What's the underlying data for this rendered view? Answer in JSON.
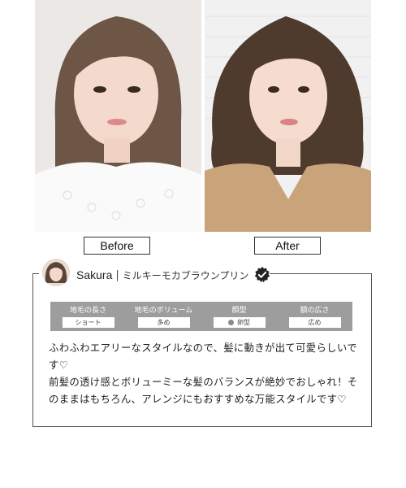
{
  "photos": {
    "before_alt": "Before",
    "after_alt": "After"
  },
  "labels": {
    "before": "Before",
    "after": "After"
  },
  "review": {
    "reviewer_name": "Sakura",
    "separator": "|",
    "style_name": "ミルキーモカブラウンプリン",
    "badge_icon": "check-badge-icon",
    "attributes": [
      {
        "label": "地毛の長さ",
        "value": "ショート"
      },
      {
        "label": "地毛のボリューム",
        "value": "多め"
      },
      {
        "label": "顔型",
        "value": "卵型"
      },
      {
        "label": "額の広さ",
        "value": "広め"
      }
    ],
    "text": "ふわふわエアリーなスタイルなので、髪に動きが出て可愛らしいです♡\n前髪の透け感とボリューミーな髪のバランスが絶妙でおしゃれ！そのままはもちろん、アレンジにもおすすめな万能スタイルです♡"
  }
}
